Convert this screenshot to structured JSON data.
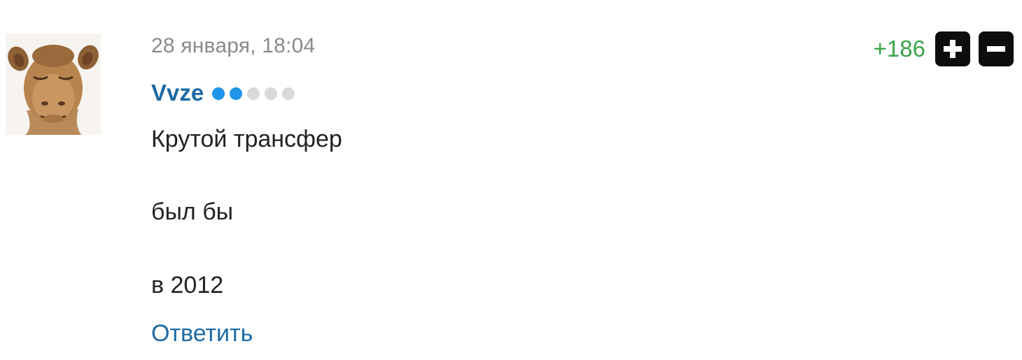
{
  "comment": {
    "avatar_icon": "camel-avatar",
    "timestamp": "28 января, 18:04",
    "author": {
      "name": "Vvze",
      "rank_level": 2,
      "rank_max": 5
    },
    "rating": {
      "value": "+186",
      "upvote_icon": "plus-icon",
      "downvote_icon": "minus-icon"
    },
    "text_lines": [
      "Крутой трансфер",
      "был бы",
      "в 2012"
    ],
    "reply_label": "Ответить"
  },
  "colors": {
    "rating_positive": "#3aa24a",
    "author_link": "#1d6aa3",
    "rank_active": "#1e95e8",
    "rank_inactive": "#d9d9d9",
    "timestamp": "#8a8a8a",
    "vote_button": "#0d0d0d"
  }
}
